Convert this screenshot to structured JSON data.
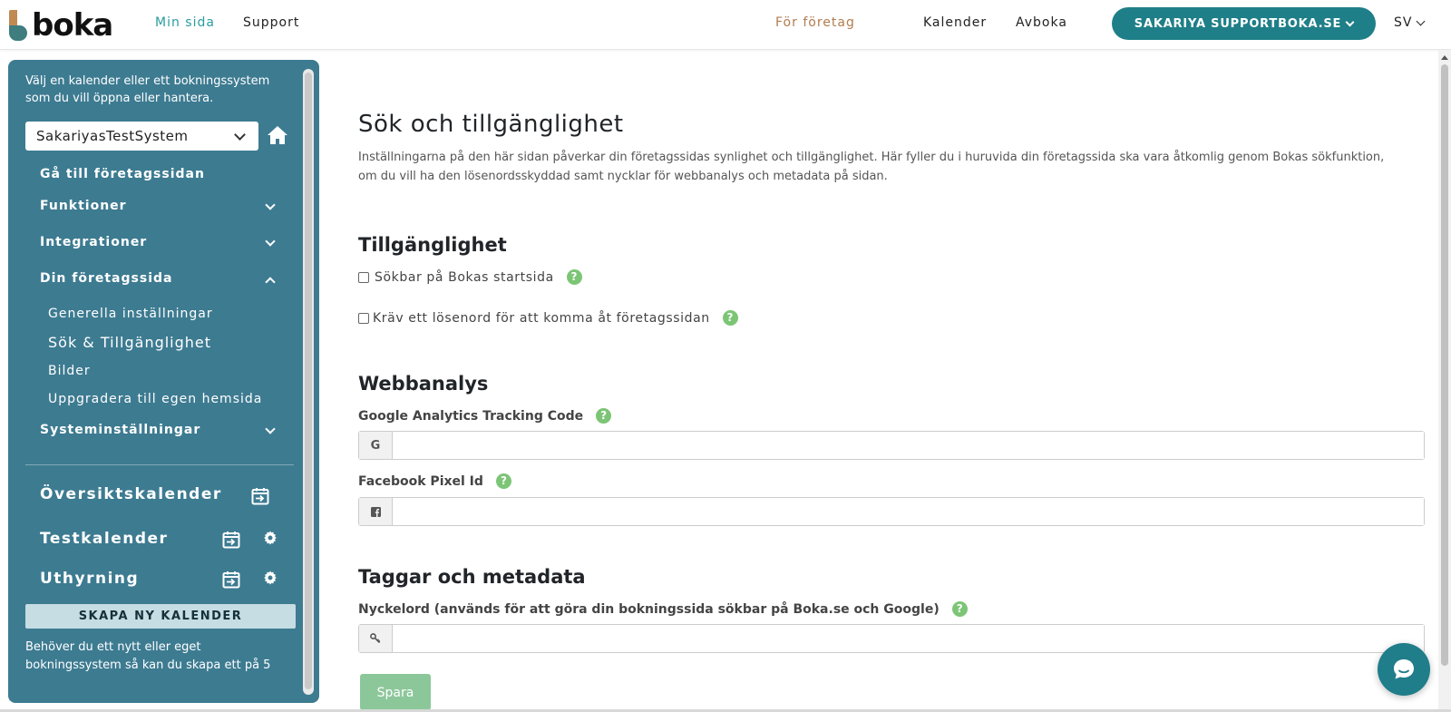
{
  "header": {
    "logo_text": "boka",
    "nav": {
      "my_page": "Min sida",
      "support": "Support",
      "business": "För företag",
      "calendar": "Kalender",
      "cancel": "Avboka"
    },
    "user_button": "SAKARIYA SUPPORTBOKA.SE",
    "language": "SV"
  },
  "sidebar": {
    "intro": "Välj en kalender eller ett bokningssystem som du vill öppna eller hantera.",
    "system_select": "SakariyasTestSystem",
    "go_to_company_page": "Gå till företagssidan",
    "items": {
      "functions": "Funktioner",
      "integrations": "Integrationer",
      "company_page": "Din företagssida",
      "system_settings": "Systeminställningar"
    },
    "subitems": {
      "general": "Generella inställningar",
      "search": "Sök & Tillgänglighet",
      "images": "Bilder",
      "upgrade": "Uppgradera till egen hemsida"
    },
    "calendars": {
      "overview": "Översiktskalender",
      "test": "Testkalender",
      "rental": "Uthyrning"
    },
    "new_calendar_button": "SKAPA NY KALENDER",
    "footer_text": "Behöver du ett nytt eller eget bokningssystem så kan du skapa ett på 5"
  },
  "main": {
    "title": "Sök och tillgänglighet",
    "description": "Inställningarna på den här sidan påverkar din företagssidas synlighet och tillgänglighet. Här fyller du i huruvida din företagssida ska vara åtkomlig genom Bokas sökfunktion, om du vill ha den lösenordsskyddad samt nycklar för webbanalys och metadata på sidan.",
    "accessibility": {
      "heading": "Tillgänglighet",
      "searchable_label": "Sökbar på Bokas startsida",
      "password_label": "Kräv ett lösenord för att komma åt företagssidan"
    },
    "analytics": {
      "heading": "Webbanalys",
      "ga_label": "Google Analytics Tracking Code",
      "ga_addon": "G",
      "ga_value": "",
      "fb_label": "Facebook Pixel Id",
      "fb_value": ""
    },
    "metadata": {
      "heading": "Taggar och metadata",
      "keywords_label": "Nyckelord (används för att göra din bokningssida sökbar på Boka.se och Google)",
      "keywords_value": ""
    },
    "save_button": "Spara"
  },
  "icons": {
    "help": "question-circle-icon",
    "home": "home-icon",
    "calendar": "calendar-arrow-icon",
    "gear": "gear-icon",
    "chat": "chat-bubble-icon"
  },
  "colors": {
    "brand_teal": "#1f7f88",
    "sidebar_bg": "#3d7b91",
    "accent_green": "#7cc576",
    "business_link": "#b27d4f"
  }
}
